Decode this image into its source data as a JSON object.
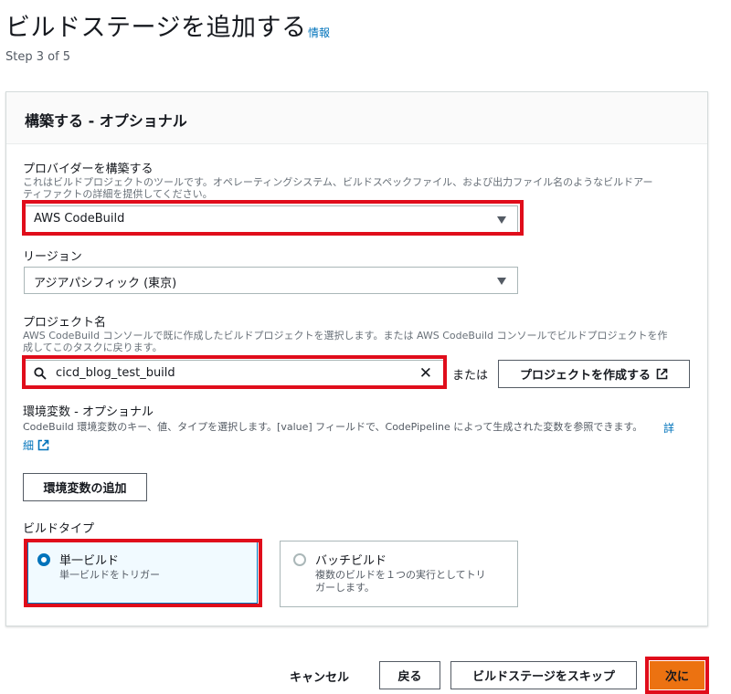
{
  "header": {
    "title": "ビルドステージを追加する",
    "info_link": "情報",
    "step": "Step 3 of 5"
  },
  "panel": {
    "title": "構築する - オプショナル"
  },
  "provider": {
    "label": "プロバイダーを構築する",
    "description_line1": "これはビルドプロジェクトのツールです。オペレーティングシステム、ビルドスペックファイル、および出力ファイル名のようなビルドアー",
    "description_line2": "ティファクトの詳細を提供してください。",
    "selected": "AWS CodeBuild"
  },
  "region": {
    "label": "リージョン",
    "selected": "アジアパシフィック (東京)"
  },
  "project": {
    "label": "プロジェクト名",
    "description_line1": "AWS CodeBuild コンソールで既に作成したビルドプロジェクトを選択します。または AWS CodeBuild コンソールでビルドプロジェクトを作",
    "description_line2": "成してこのタスクに戻ります。",
    "value": "cicd_blog_test_build",
    "or_text": "または",
    "create_button": "プロジェクトを作成する"
  },
  "env": {
    "label": "環境変数 - オプショナル",
    "description": "CodeBuild 環境変数のキー、値、タイプを選択します。[value] フィールドで、CodePipeline によって生成された変数を参照できます。",
    "detail_link_1": "詳",
    "detail_link_2": "細",
    "add_button": "環境変数の追加"
  },
  "build_type": {
    "label": "ビルドタイプ",
    "options": [
      {
        "title": "単一ビルド",
        "desc_line1": "単一ビルドをトリガー",
        "desc_line2": "",
        "selected": true
      },
      {
        "title": "バッチビルド",
        "desc_line1": "複数のビルドを１つの実行としてトリ",
        "desc_line2": "ガーします。",
        "selected": false
      }
    ]
  },
  "footer": {
    "cancel": "キャンセル",
    "back": "戻る",
    "skip": "ビルドステージをスキップ",
    "next": "次に"
  },
  "colors": {
    "accent": "#0073bb",
    "primary_button": "#ec7211",
    "highlight": "#e00d1b"
  }
}
